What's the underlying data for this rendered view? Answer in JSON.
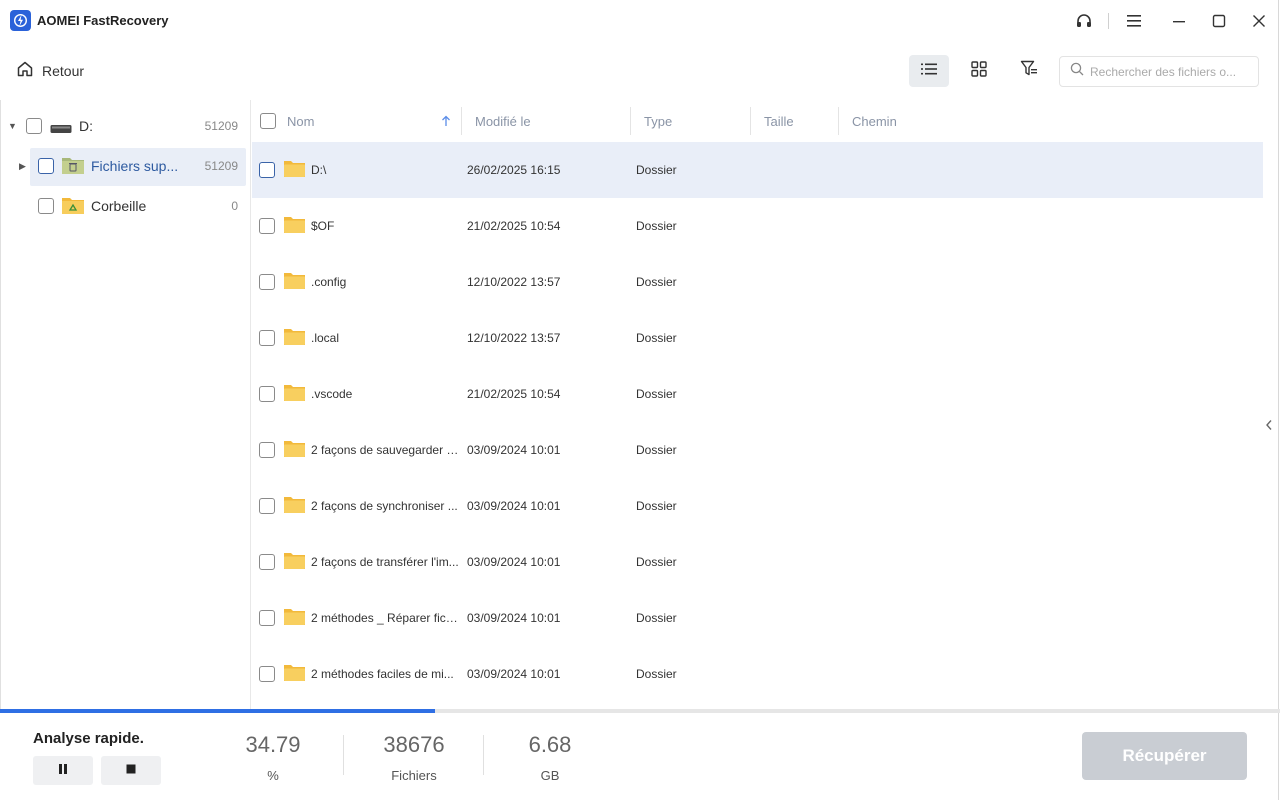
{
  "app": {
    "title": "AOMEI FastRecovery"
  },
  "toolbar": {
    "back_label": "Retour",
    "search_placeholder": "Rechercher des fichiers o..."
  },
  "tree": [
    {
      "label": "D:",
      "count": "51209",
      "icon": "drive-icon"
    },
    {
      "label": "Fichiers sup...",
      "count": "51209",
      "icon": "deleted-folder-icon"
    },
    {
      "label": "Corbeille",
      "count": "0",
      "icon": "recycle-bin-icon"
    }
  ],
  "table": {
    "columns": [
      "Nom",
      "Modifié le",
      "Type",
      "Taille",
      "Chemin"
    ],
    "rows": [
      {
        "name": "D:\\",
        "date": "26/02/2025 16:15",
        "type": "Dossier"
      },
      {
        "name": "$OF",
        "date": "21/02/2025 10:54",
        "type": "Dossier"
      },
      {
        "name": ".config",
        "date": "12/10/2022 13:57",
        "type": "Dossier"
      },
      {
        "name": ".local",
        "date": "12/10/2022 13:57",
        "type": "Dossier"
      },
      {
        "name": ".vscode",
        "date": "21/02/2025 10:54",
        "type": "Dossier"
      },
      {
        "name": "2 façons de sauvegarder s...",
        "date": "03/09/2024 10:01",
        "type": "Dossier"
      },
      {
        "name": "2 façons de synchroniser ...",
        "date": "03/09/2024 10:01",
        "type": "Dossier"
      },
      {
        "name": "2 façons de transférer l'im...",
        "date": "03/09/2024 10:01",
        "type": "Dossier"
      },
      {
        "name": "2 méthodes _ Réparer fich...",
        "date": "03/09/2024 10:01",
        "type": "Dossier"
      },
      {
        "name": "2 méthodes faciles de mi...",
        "date": "03/09/2024 10:01",
        "type": "Dossier"
      }
    ]
  },
  "scan": {
    "title": "Analyse rapide.",
    "progress_fraction": 0.34,
    "percent_value": "34.79",
    "percent_label": "%",
    "files_value": "38676",
    "files_label": "Fichiers",
    "size_value": "6.68",
    "size_label": "GB",
    "recover_label": "Récupérer"
  },
  "colors": {
    "accent": "#2f6fe4",
    "logo": "#2a62d9",
    "selection": "#e9eef8",
    "folder": "#f7c948"
  }
}
